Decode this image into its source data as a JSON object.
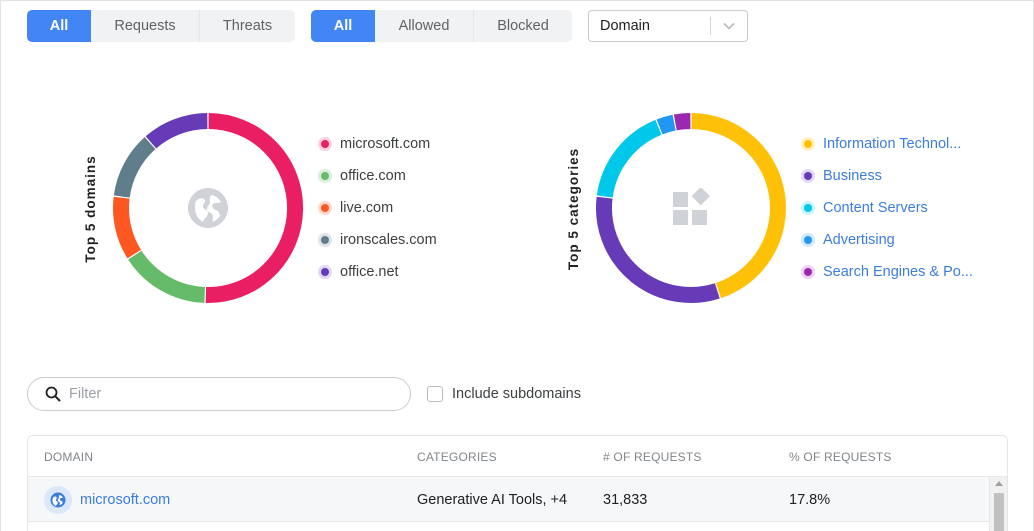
{
  "filters": {
    "type_group": [
      {
        "label": "All",
        "active": true
      },
      {
        "label": "Requests",
        "active": false
      },
      {
        "label": "Threats",
        "active": false
      }
    ],
    "action_group": [
      {
        "label": "All",
        "active": true
      },
      {
        "label": "Allowed",
        "active": false
      },
      {
        "label": "Blocked",
        "active": false
      }
    ],
    "group_by_select": {
      "value": "Domain"
    }
  },
  "chart_data": [
    {
      "type": "pie",
      "title": "Top 5 domains",
      "center_icon": "globe-icon",
      "categories": [
        "microsoft.com",
        "office.com",
        "live.com",
        "ironscales.com",
        "office.net"
      ],
      "values": [
        50.5,
        15.5,
        11,
        11.5,
        11.5
      ],
      "colors": [
        "#e91e63",
        "#66bb6a",
        "#ff5722",
        "#607d8b",
        "#673ab7"
      ]
    },
    {
      "type": "pie",
      "title": "Top 5 categories",
      "center_icon": "categories-icon",
      "categories": [
        "Information Technol...",
        "Business",
        "Content Servers",
        "Advertising",
        "Search Engines & Po..."
      ],
      "values": [
        45,
        32,
        17,
        3,
        3
      ],
      "colors": [
        "#ffc107",
        "#673ab7",
        "#00c8ea",
        "#2196f3",
        "#9c27b0"
      ]
    }
  ],
  "search": {
    "placeholder": "Filter"
  },
  "include_subdomains": {
    "label": "Include subdomains",
    "checked": false
  },
  "table": {
    "columns": [
      "DOMAIN",
      "CATEGORIES",
      "# OF REQUESTS",
      "% OF REQUESTS"
    ],
    "rows": [
      {
        "domain": "microsoft.com",
        "categories": "Generative AI Tools, +4",
        "requests": "31,833",
        "percent": "17.8%"
      }
    ]
  }
}
